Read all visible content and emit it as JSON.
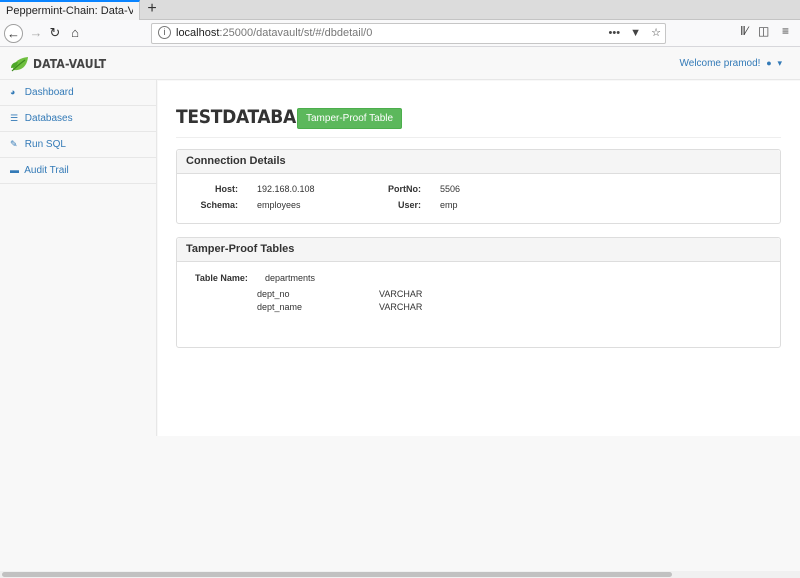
{
  "browser": {
    "tab_title": "Peppermint-Chain: Data-Va",
    "new_tab": "+",
    "url_host": "localhost",
    "url_path": ":25000/datavault/st/#/dbdetail/0",
    "icons": [
      "back-icon",
      "forward-icon",
      "reload-icon",
      "home-icon",
      "info-icon",
      "more-icon",
      "pocket-icon",
      "star-icon",
      "library-icon",
      "sidebar-icon",
      "menu-icon"
    ]
  },
  "header": {
    "brand": "DATA-VAULT",
    "welcome": "Welcome pramod!",
    "brand_color": "#5cb85c"
  },
  "sidebar": {
    "items": [
      {
        "label": "Dashboard",
        "icon": "dashboard-icon"
      },
      {
        "label": "Databases",
        "icon": "database-icon"
      },
      {
        "label": "Run SQL",
        "icon": "pencil-icon"
      },
      {
        "label": "Audit Trail",
        "icon": "card-icon"
      }
    ]
  },
  "main": {
    "title": "TESTDATABASE",
    "tamper_button": "Tamper-Proof Table",
    "connection": {
      "heading": "Connection Details",
      "host_label": "Host:",
      "host": "192.168.0.108",
      "port_label": "PortNo:",
      "port": "5506",
      "schema_label": "Schema:",
      "schema": "employees",
      "user_label": "User:",
      "user": "emp"
    },
    "tamper_proof": {
      "heading": "Tamper-Proof Tables",
      "table_name_label": "Table Name:",
      "table_name": "departments",
      "columns": [
        {
          "name": "dept_no",
          "type": "VARCHAR"
        },
        {
          "name": "dept_name",
          "type": "VARCHAR"
        }
      ]
    }
  },
  "colors": {
    "link": "#337ab7",
    "accent_green": "#5cb85c"
  }
}
